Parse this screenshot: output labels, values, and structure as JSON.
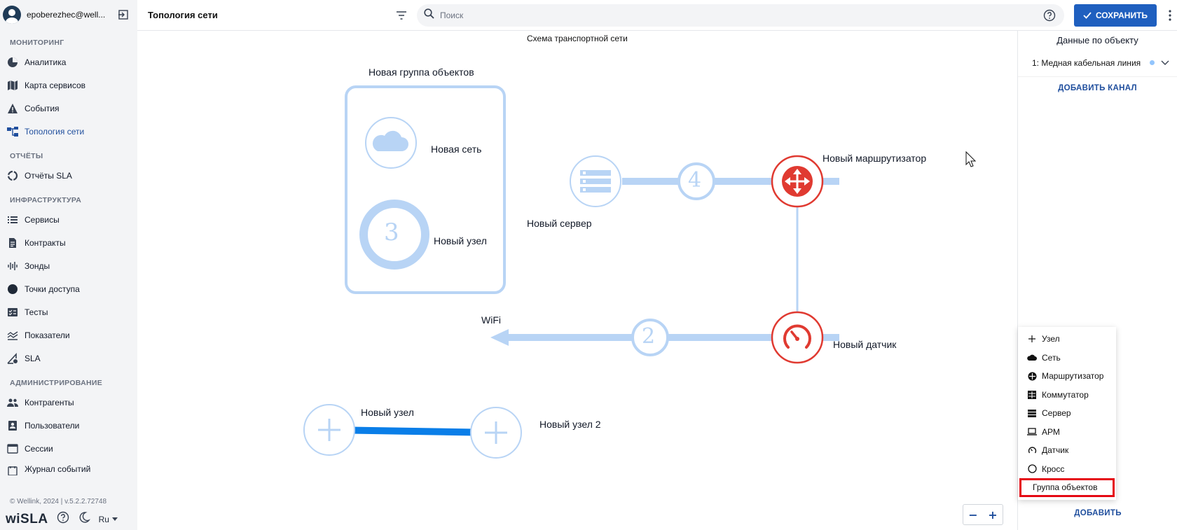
{
  "user": {
    "name": "epoberezhec@well..."
  },
  "sidebar": {
    "sections": [
      {
        "title": "МОНИТОРИНГ",
        "items": [
          {
            "label": "Аналитика",
            "icon": "pie-chart-icon"
          },
          {
            "label": "Карта сервисов",
            "icon": "map-icon"
          },
          {
            "label": "События",
            "icon": "warning-icon"
          },
          {
            "label": "Топология сети",
            "icon": "topology-icon",
            "active": true
          }
        ]
      },
      {
        "title": "ОТЧЁТЫ",
        "items": [
          {
            "label": "Отчёты SLA",
            "icon": "circle-report-icon"
          }
        ]
      },
      {
        "title": "ИНФРАСТРУКТУРА",
        "items": [
          {
            "label": "Сервисы",
            "icon": "list-icon"
          },
          {
            "label": "Контракты",
            "icon": "document-icon"
          },
          {
            "label": "Зонды",
            "icon": "probe-icon"
          },
          {
            "label": "Точки доступа",
            "icon": "dot-icon"
          },
          {
            "label": "Тесты",
            "icon": "checklist-icon"
          },
          {
            "label": "Показатели",
            "icon": "metrics-icon"
          },
          {
            "label": "SLA",
            "icon": "sla-icon"
          }
        ]
      },
      {
        "title": "АДМИНИСТРИРОВАНИЕ",
        "items": [
          {
            "label": "Контрагенты",
            "icon": "people-icon"
          },
          {
            "label": "Пользователи",
            "icon": "user-card-icon"
          },
          {
            "label": "Сессии",
            "icon": "window-icon"
          },
          {
            "label": "Журнал событий",
            "icon": "journal-icon"
          }
        ]
      }
    ],
    "copyright": "© Wellink, 2024 | v.5.2.2.72748",
    "logo": "wiSLA",
    "language": "Ru"
  },
  "header": {
    "title": "Топология сети",
    "search_placeholder": "Поиск",
    "save_label": "СОХРАНИТЬ"
  },
  "canvas": {
    "scheme_title": "Схема транспортной сети",
    "group_label": "Новая группа объектов",
    "nodes": {
      "network": "Новая сеть",
      "node_group": "Новый узел",
      "node_group_badge": "3",
      "server": "Новый сервер",
      "router": "Новый маршрутизатор",
      "sensor": "Новый датчик",
      "wifi": "WiFi",
      "node1": "Новый узел",
      "node2": "Новый узел 2"
    },
    "link_badges": {
      "server_router": "4",
      "sensor_wifi": "2"
    },
    "colors": {
      "light_blue": "#b8d4f5",
      "bright_blue": "#0a7ee8",
      "red": "#e03a31"
    },
    "zoom_out": "−",
    "zoom_in": "+"
  },
  "panel": {
    "title": "Данные по объекту",
    "channel": "1: Медная кабельная линия",
    "add_channel": "ДОБАВИТЬ КАНАЛ",
    "menu": [
      {
        "label": "Узел",
        "icon": "plus-icon"
      },
      {
        "label": "Сеть",
        "icon": "cloud-icon"
      },
      {
        "label": "Маршрутизатор",
        "icon": "router-icon"
      },
      {
        "label": "Коммутатор",
        "icon": "switch-icon"
      },
      {
        "label": "Сервер",
        "icon": "server-icon"
      },
      {
        "label": "АРМ",
        "icon": "laptop-icon"
      },
      {
        "label": "Датчик",
        "icon": "gauge-icon"
      },
      {
        "label": "Кросс",
        "icon": "circle-icon"
      },
      {
        "label": "Группа объектов",
        "icon": "",
        "highlight": true
      }
    ],
    "add_label": "ДОБАВИТЬ"
  }
}
